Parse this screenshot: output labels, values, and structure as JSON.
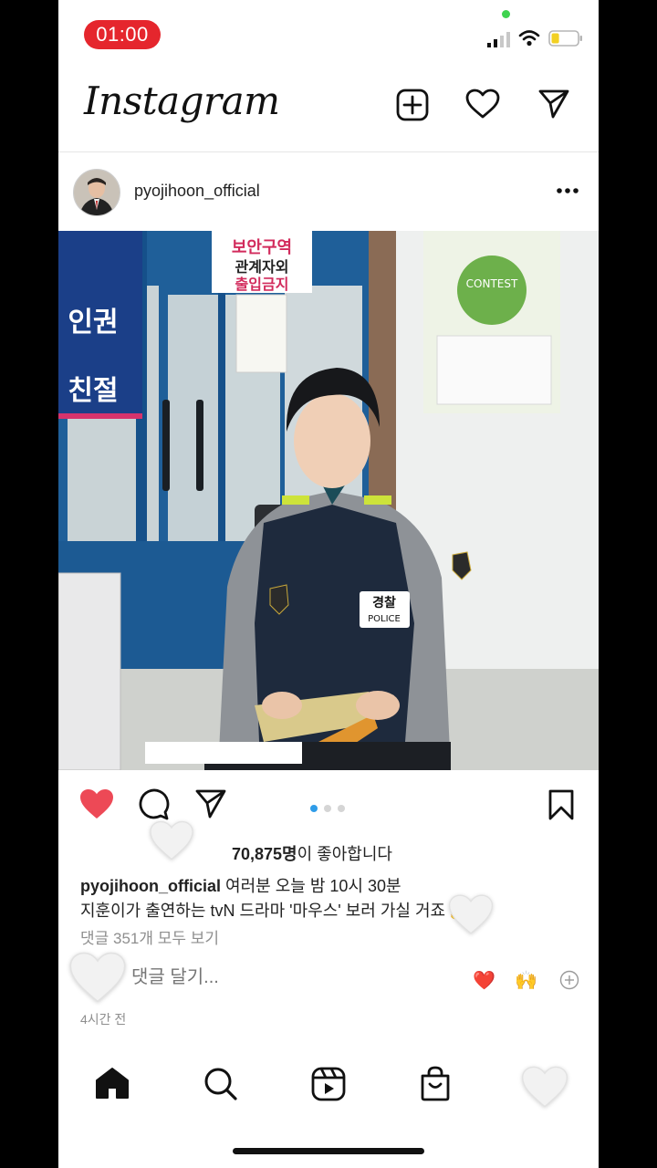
{
  "status_bar": {
    "time": "01:00",
    "battery_level": 0.3
  },
  "header": {
    "app_name": "Instagram"
  },
  "post": {
    "username": "pyojihoon_official",
    "photo_signs": {
      "top_sign_line1": "보안구역",
      "top_sign_line2": "관계자외",
      "top_sign_line3": "출입금지",
      "banner_text1": "인권",
      "banner_text2": "친절",
      "patch_text": "경찰",
      "patch_sub": "POLICE",
      "badge_text": "POLICE",
      "contest_text": "CONTEST"
    },
    "carousel": {
      "total": 3,
      "active_index": 0
    },
    "liked": true,
    "likes_count": "70,875명",
    "likes_suffix": "이 좋아합니다",
    "caption_user": "pyojihoon_official",
    "caption_line1": " 여러분 오늘 밤 10시 30분",
    "caption_line2": "지훈이가 출연하는 tvN 드라마 '마우스' 보러 가실 거죠",
    "caption_emoji": "🤗",
    "view_comments": "댓글 351개 모두 보기",
    "comment_placeholder": "댓글 달기...",
    "quick_emojis": [
      "❤️",
      "🙌"
    ],
    "time_ago": "4시간 전"
  },
  "colors": {
    "like_red": "#ed4956",
    "accent_blue": "#2f9ce8",
    "status_red": "#e5262d"
  },
  "icons": [
    "new-post-icon",
    "heart-icon",
    "send-icon",
    "more-icon",
    "comment-icon",
    "bookmark-icon",
    "home-icon",
    "search-icon",
    "reels-icon",
    "shop-icon"
  ]
}
